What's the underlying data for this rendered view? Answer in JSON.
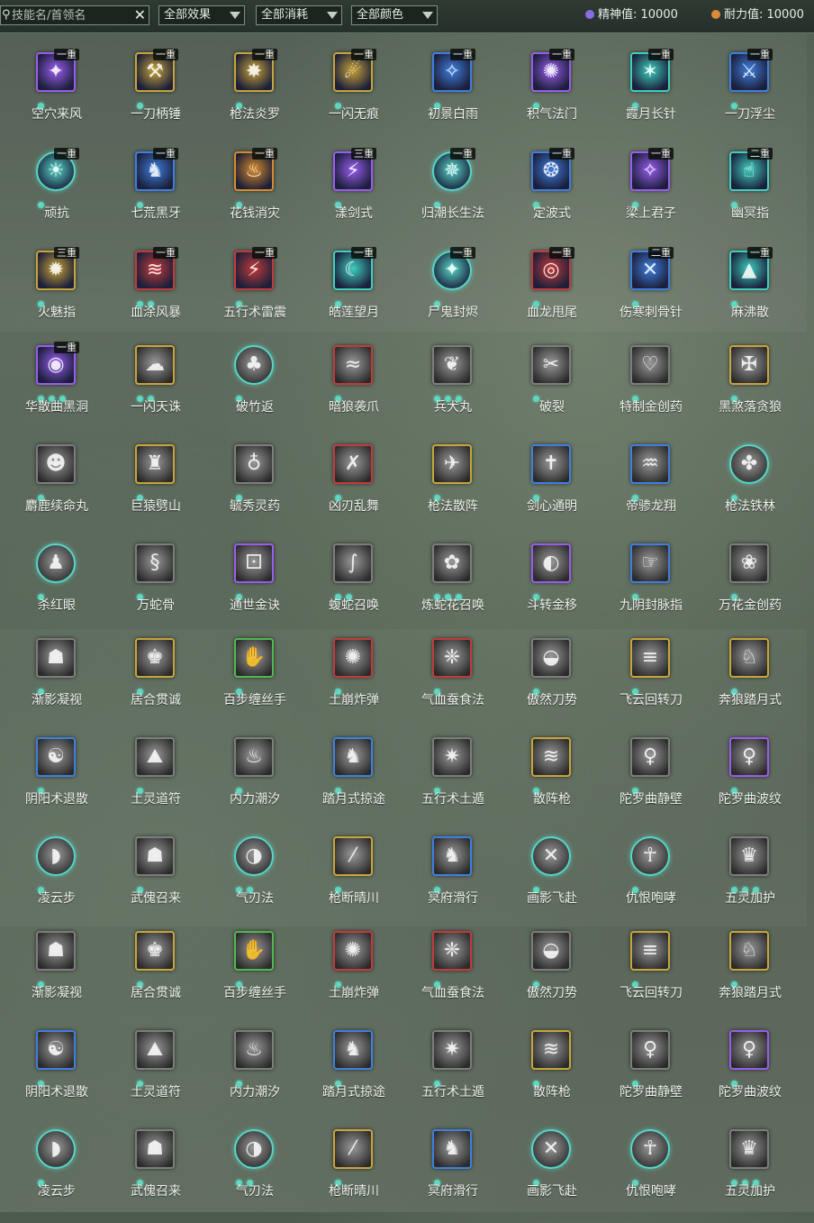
{
  "toolbar": {
    "search_placeholder": "技能名/首领名",
    "effect_filter": "全部效果",
    "cost_filter": "全部消耗",
    "color_filter": "全部颜色",
    "spirit_label": "精神值: 10000",
    "stamina_label": "耐力值: 10000"
  },
  "skills": [
    {
      "name": "空穴来风",
      "level": "一重",
      "dots": 1,
      "frame": "purple",
      "colored": true,
      "sym": "✦"
    },
    {
      "name": "一刀柄锤",
      "level": "一重",
      "dots": 1,
      "frame": "gold",
      "colored": true,
      "sym": "⚒"
    },
    {
      "name": "枪法炎罗",
      "level": "一重",
      "dots": 1,
      "frame": "gold",
      "colored": true,
      "sym": "✸"
    },
    {
      "name": "一闪无痕",
      "level": "一重",
      "dots": 1,
      "frame": "gold",
      "colored": true,
      "sym": "☄"
    },
    {
      "name": "初景白雨",
      "level": "一重",
      "dots": 1,
      "frame": "blue",
      "colored": true,
      "sym": "✧"
    },
    {
      "name": "积气法门",
      "level": "一重",
      "dots": 1,
      "frame": "purple",
      "colored": true,
      "sym": "✺"
    },
    {
      "name": "霞月长针",
      "level": "一重",
      "dots": 1,
      "frame": "teal",
      "colored": true,
      "sym": "✶"
    },
    {
      "name": "一刀浮尘",
      "level": "一重",
      "dots": 1,
      "frame": "blue",
      "colored": true,
      "sym": "⚔"
    },
    {
      "name": "顽抗",
      "level": "一重",
      "dots": 1,
      "frame": "round",
      "colored": true,
      "sym": "☀"
    },
    {
      "name": "七荒黑牙",
      "level": "一重",
      "dots": 1,
      "frame": "blue",
      "colored": true,
      "sym": "♞"
    },
    {
      "name": "花钱消灾",
      "level": "一重",
      "dots": 1,
      "frame": "orange",
      "colored": true,
      "sym": "♨"
    },
    {
      "name": "漾剑式",
      "level": "三重",
      "dots": 1,
      "frame": "purple",
      "colored": true,
      "sym": "⚡"
    },
    {
      "name": "归潮长生法",
      "level": "一重",
      "dots": 1,
      "frame": "round",
      "colored": true,
      "sym": "✵"
    },
    {
      "name": "定波式",
      "level": "一重",
      "dots": 1,
      "frame": "blue",
      "colored": true,
      "sym": "❂"
    },
    {
      "name": "梁上君子",
      "level": "一重",
      "dots": 1,
      "frame": "purple",
      "colored": true,
      "sym": "✧"
    },
    {
      "name": "幽冥指",
      "level": "二重",
      "dots": 1,
      "frame": "teal",
      "colored": true,
      "sym": "☝"
    },
    {
      "name": "火魅指",
      "level": "三重",
      "dots": 1,
      "frame": "gold",
      "colored": true,
      "sym": "✹"
    },
    {
      "name": "血涂风暴",
      "level": "一重",
      "dots": 2,
      "frame": "red",
      "colored": true,
      "sym": "≋"
    },
    {
      "name": "五行术雷震",
      "level": "一重",
      "dots": 1,
      "frame": "red",
      "colored": true,
      "sym": "⚡"
    },
    {
      "name": "皓莲望月",
      "level": "一重",
      "dots": 1,
      "frame": "teal",
      "colored": true,
      "sym": "☾"
    },
    {
      "name": "尸鬼封烬",
      "level": "一重",
      "dots": 1,
      "frame": "round",
      "colored": true,
      "sym": "✦"
    },
    {
      "name": "血龙甩尾",
      "level": "一重",
      "dots": 1,
      "frame": "red",
      "colored": true,
      "sym": "◎"
    },
    {
      "name": "伤寒刺骨针",
      "level": "二重",
      "dots": 1,
      "frame": "blue",
      "colored": true,
      "sym": "✕"
    },
    {
      "name": "麻沸散",
      "level": "一重",
      "dots": 1,
      "frame": "teal",
      "colored": true,
      "sym": "▲"
    },
    {
      "name": "华散曲黑洞",
      "level": "一重",
      "dots": 3,
      "frame": "purple",
      "colored": true,
      "sym": "◉"
    },
    {
      "name": "一闪天诛",
      "level": "",
      "dots": 2,
      "frame": "gold",
      "colored": false,
      "sym": "☁"
    },
    {
      "name": "破竹返",
      "level": "",
      "dots": 1,
      "frame": "round",
      "colored": false,
      "sym": "♣"
    },
    {
      "name": "暗狼袭爪",
      "level": "",
      "dots": 1,
      "frame": "red",
      "colored": false,
      "sym": "≈"
    },
    {
      "name": "兵犬丸",
      "level": "",
      "dots": 3,
      "frame": "grey",
      "colored": false,
      "sym": "❦"
    },
    {
      "name": "破裂",
      "level": "",
      "dots": 1,
      "frame": "grey",
      "colored": false,
      "sym": "✂"
    },
    {
      "name": "特制金创药",
      "level": "",
      "dots": 1,
      "frame": "grey",
      "colored": false,
      "sym": "♡"
    },
    {
      "name": "黑煞落贪狼",
      "level": "",
      "dots": 1,
      "frame": "gold",
      "colored": false,
      "sym": "✠"
    },
    {
      "name": "麝鹿续命丸",
      "level": "",
      "dots": 1,
      "frame": "grey",
      "colored": false,
      "sym": "☻"
    },
    {
      "name": "巨猿劈山",
      "level": "",
      "dots": 1,
      "frame": "gold",
      "colored": false,
      "sym": "♜"
    },
    {
      "name": "毓秀灵药",
      "level": "",
      "dots": 1,
      "frame": "grey",
      "colored": false,
      "sym": "♁"
    },
    {
      "name": "凶刃乱舞",
      "level": "",
      "dots": 1,
      "frame": "red",
      "colored": false,
      "sym": "✗"
    },
    {
      "name": "枪法散阵",
      "level": "",
      "dots": 1,
      "frame": "gold",
      "colored": false,
      "sym": "✈"
    },
    {
      "name": "剑心通明",
      "level": "",
      "dots": 1,
      "frame": "blue",
      "colored": false,
      "sym": "✝"
    },
    {
      "name": "帝骖龙翔",
      "level": "",
      "dots": 1,
      "frame": "blue",
      "colored": false,
      "sym": "♒"
    },
    {
      "name": "枪法铁林",
      "level": "",
      "dots": 1,
      "frame": "round",
      "colored": false,
      "sym": "✤"
    },
    {
      "name": "杀红眼",
      "level": "",
      "dots": 1,
      "frame": "round",
      "colored": false,
      "sym": "♟"
    },
    {
      "name": "万蛇骨",
      "level": "",
      "dots": 1,
      "frame": "grey",
      "colored": false,
      "sym": "§"
    },
    {
      "name": "通世金诀",
      "level": "",
      "dots": 1,
      "frame": "purple",
      "colored": false,
      "sym": "⚀"
    },
    {
      "name": "蝮蛇召唤",
      "level": "",
      "dots": 2,
      "frame": "grey",
      "colored": false,
      "sym": "∫"
    },
    {
      "name": "炼蛇花召唤",
      "level": "",
      "dots": 3,
      "frame": "grey",
      "colored": false,
      "sym": "✿"
    },
    {
      "name": "斗转金移",
      "level": "",
      "dots": 1,
      "frame": "purple",
      "colored": false,
      "sym": "◐"
    },
    {
      "name": "九阴封脉指",
      "level": "",
      "dots": 1,
      "frame": "blue",
      "colored": false,
      "sym": "☞"
    },
    {
      "name": "万花金创药",
      "level": "",
      "dots": 1,
      "frame": "grey",
      "colored": false,
      "sym": "❀"
    },
    {
      "name": "渐影凝视",
      "level": "",
      "dots": 1,
      "frame": "grey",
      "colored": false,
      "sym": "☗"
    },
    {
      "name": "居合贯诚",
      "level": "",
      "dots": 1,
      "frame": "gold",
      "colored": false,
      "sym": "♚"
    },
    {
      "name": "百步缠丝手",
      "level": "",
      "dots": 1,
      "frame": "green",
      "colored": false,
      "sym": "✋"
    },
    {
      "name": "土崩炸弹",
      "level": "",
      "dots": 1,
      "frame": "red",
      "colored": false,
      "sym": "✺"
    },
    {
      "name": "气血蚕食法",
      "level": "",
      "dots": 1,
      "frame": "red",
      "colored": false,
      "sym": "❈"
    },
    {
      "name": "傲然刀势",
      "level": "",
      "dots": 1,
      "frame": "grey",
      "colored": false,
      "sym": "◒"
    },
    {
      "name": "飞云回转刀",
      "level": "",
      "dots": 1,
      "frame": "gold",
      "colored": false,
      "sym": "≡"
    },
    {
      "name": "奔狼踏月式",
      "level": "",
      "dots": 1,
      "frame": "gold",
      "colored": false,
      "sym": "♘"
    },
    {
      "name": "阴阳术退散",
      "level": "",
      "dots": 1,
      "frame": "blue",
      "colored": false,
      "sym": "☯"
    },
    {
      "name": "土灵道符",
      "level": "",
      "dots": 1,
      "frame": "grey",
      "colored": false,
      "sym": "⛰"
    },
    {
      "name": "内力潮汐",
      "level": "",
      "dots": 1,
      "frame": "grey",
      "colored": false,
      "sym": "♨"
    },
    {
      "name": "踏月式掠途",
      "level": "",
      "dots": 1,
      "frame": "blue",
      "colored": false,
      "sym": "♞"
    },
    {
      "name": "五行术土遁",
      "level": "",
      "dots": 1,
      "frame": "grey",
      "colored": false,
      "sym": "✷"
    },
    {
      "name": "散阵枪",
      "level": "",
      "dots": 1,
      "frame": "gold",
      "colored": false,
      "sym": "≋"
    },
    {
      "name": "陀罗曲静壁",
      "level": "",
      "dots": 1,
      "frame": "grey",
      "colored": false,
      "sym": "♀"
    },
    {
      "name": "陀罗曲波纹",
      "level": "",
      "dots": 1,
      "frame": "purple",
      "colored": false,
      "sym": "♀"
    },
    {
      "name": "凌云步",
      "level": "",
      "dots": 1,
      "frame": "round",
      "colored": false,
      "sym": "◗"
    },
    {
      "name": "武傀召来",
      "level": "",
      "dots": 1,
      "frame": "grey",
      "colored": false,
      "sym": "☗"
    },
    {
      "name": "气刃法",
      "level": "",
      "dots": 2,
      "frame": "round",
      "colored": false,
      "sym": "◑"
    },
    {
      "name": "枪断晴川",
      "level": "",
      "dots": 1,
      "frame": "gold",
      "colored": false,
      "sym": "⁄"
    },
    {
      "name": "冥府滑行",
      "level": "",
      "dots": 1,
      "frame": "blue",
      "colored": false,
      "sym": "♞"
    },
    {
      "name": "画影飞赴",
      "level": "",
      "dots": 1,
      "frame": "round",
      "colored": false,
      "sym": "✕"
    },
    {
      "name": "仇恨咆哮",
      "level": "",
      "dots": 1,
      "frame": "round",
      "colored": false,
      "sym": "☥"
    },
    {
      "name": "五灵加护",
      "level": "",
      "dots": 3,
      "frame": "grey",
      "colored": false,
      "sym": "♛"
    },
    {
      "name": "渐影凝视",
      "level": "",
      "dots": 1,
      "frame": "grey",
      "colored": false,
      "sym": "☗"
    },
    {
      "name": "居合贯诚",
      "level": "",
      "dots": 1,
      "frame": "gold",
      "colored": false,
      "sym": "♚"
    },
    {
      "name": "百步缠丝手",
      "level": "",
      "dots": 1,
      "frame": "green",
      "colored": false,
      "sym": "✋"
    },
    {
      "name": "土崩炸弹",
      "level": "",
      "dots": 1,
      "frame": "red",
      "colored": false,
      "sym": "✺"
    },
    {
      "name": "气血蚕食法",
      "level": "",
      "dots": 1,
      "frame": "red",
      "colored": false,
      "sym": "❈"
    },
    {
      "name": "傲然刀势",
      "level": "",
      "dots": 1,
      "frame": "grey",
      "colored": false,
      "sym": "◒"
    },
    {
      "name": "飞云回转刀",
      "level": "",
      "dots": 1,
      "frame": "gold",
      "colored": false,
      "sym": "≡"
    },
    {
      "name": "奔狼踏月式",
      "level": "",
      "dots": 1,
      "frame": "gold",
      "colored": false,
      "sym": "♘"
    },
    {
      "name": "阴阳术退散",
      "level": "",
      "dots": 1,
      "frame": "blue",
      "colored": false,
      "sym": "☯"
    },
    {
      "name": "土灵道符",
      "level": "",
      "dots": 1,
      "frame": "grey",
      "colored": false,
      "sym": "⛰"
    },
    {
      "name": "内力潮汐",
      "level": "",
      "dots": 1,
      "frame": "grey",
      "colored": false,
      "sym": "♨"
    },
    {
      "name": "踏月式掠途",
      "level": "",
      "dots": 1,
      "frame": "blue",
      "colored": false,
      "sym": "♞"
    },
    {
      "name": "五行术土遁",
      "level": "",
      "dots": 1,
      "frame": "grey",
      "colored": false,
      "sym": "✷"
    },
    {
      "name": "散阵枪",
      "level": "",
      "dots": 1,
      "frame": "gold",
      "colored": false,
      "sym": "≋"
    },
    {
      "name": "陀罗曲静壁",
      "level": "",
      "dots": 1,
      "frame": "grey",
      "colored": false,
      "sym": "♀"
    },
    {
      "name": "陀罗曲波纹",
      "level": "",
      "dots": 1,
      "frame": "purple",
      "colored": false,
      "sym": "♀"
    },
    {
      "name": "凌云步",
      "level": "",
      "dots": 1,
      "frame": "round",
      "colored": false,
      "sym": "◗"
    },
    {
      "name": "武傀召来",
      "level": "",
      "dots": 1,
      "frame": "grey",
      "colored": false,
      "sym": "☗"
    },
    {
      "name": "气刃法",
      "level": "",
      "dots": 2,
      "frame": "round",
      "colored": false,
      "sym": "◑"
    },
    {
      "name": "枪断晴川",
      "level": "",
      "dots": 1,
      "frame": "gold",
      "colored": false,
      "sym": "⁄"
    },
    {
      "name": "冥府滑行",
      "level": "",
      "dots": 1,
      "frame": "blue",
      "colored": false,
      "sym": "♞"
    },
    {
      "name": "画影飞赴",
      "level": "",
      "dots": 1,
      "frame": "round",
      "colored": false,
      "sym": "✕"
    },
    {
      "name": "仇恨咆哮",
      "level": "",
      "dots": 1,
      "frame": "round",
      "colored": false,
      "sym": "☥"
    },
    {
      "name": "五灵加护",
      "level": "",
      "dots": 3,
      "frame": "grey",
      "colored": false,
      "sym": "♛"
    }
  ],
  "colors": {
    "purple": "#9a5cf0",
    "gold": "#c9a43a",
    "blue": "#3f7fe0",
    "teal": "#3fcfc0",
    "red": "#c23b3b",
    "orange": "#d88a2a",
    "green": "#4fb84f",
    "grey": "#7d7d7d",
    "round": "#56d6c8",
    "dot": "#5fd6c0"
  }
}
